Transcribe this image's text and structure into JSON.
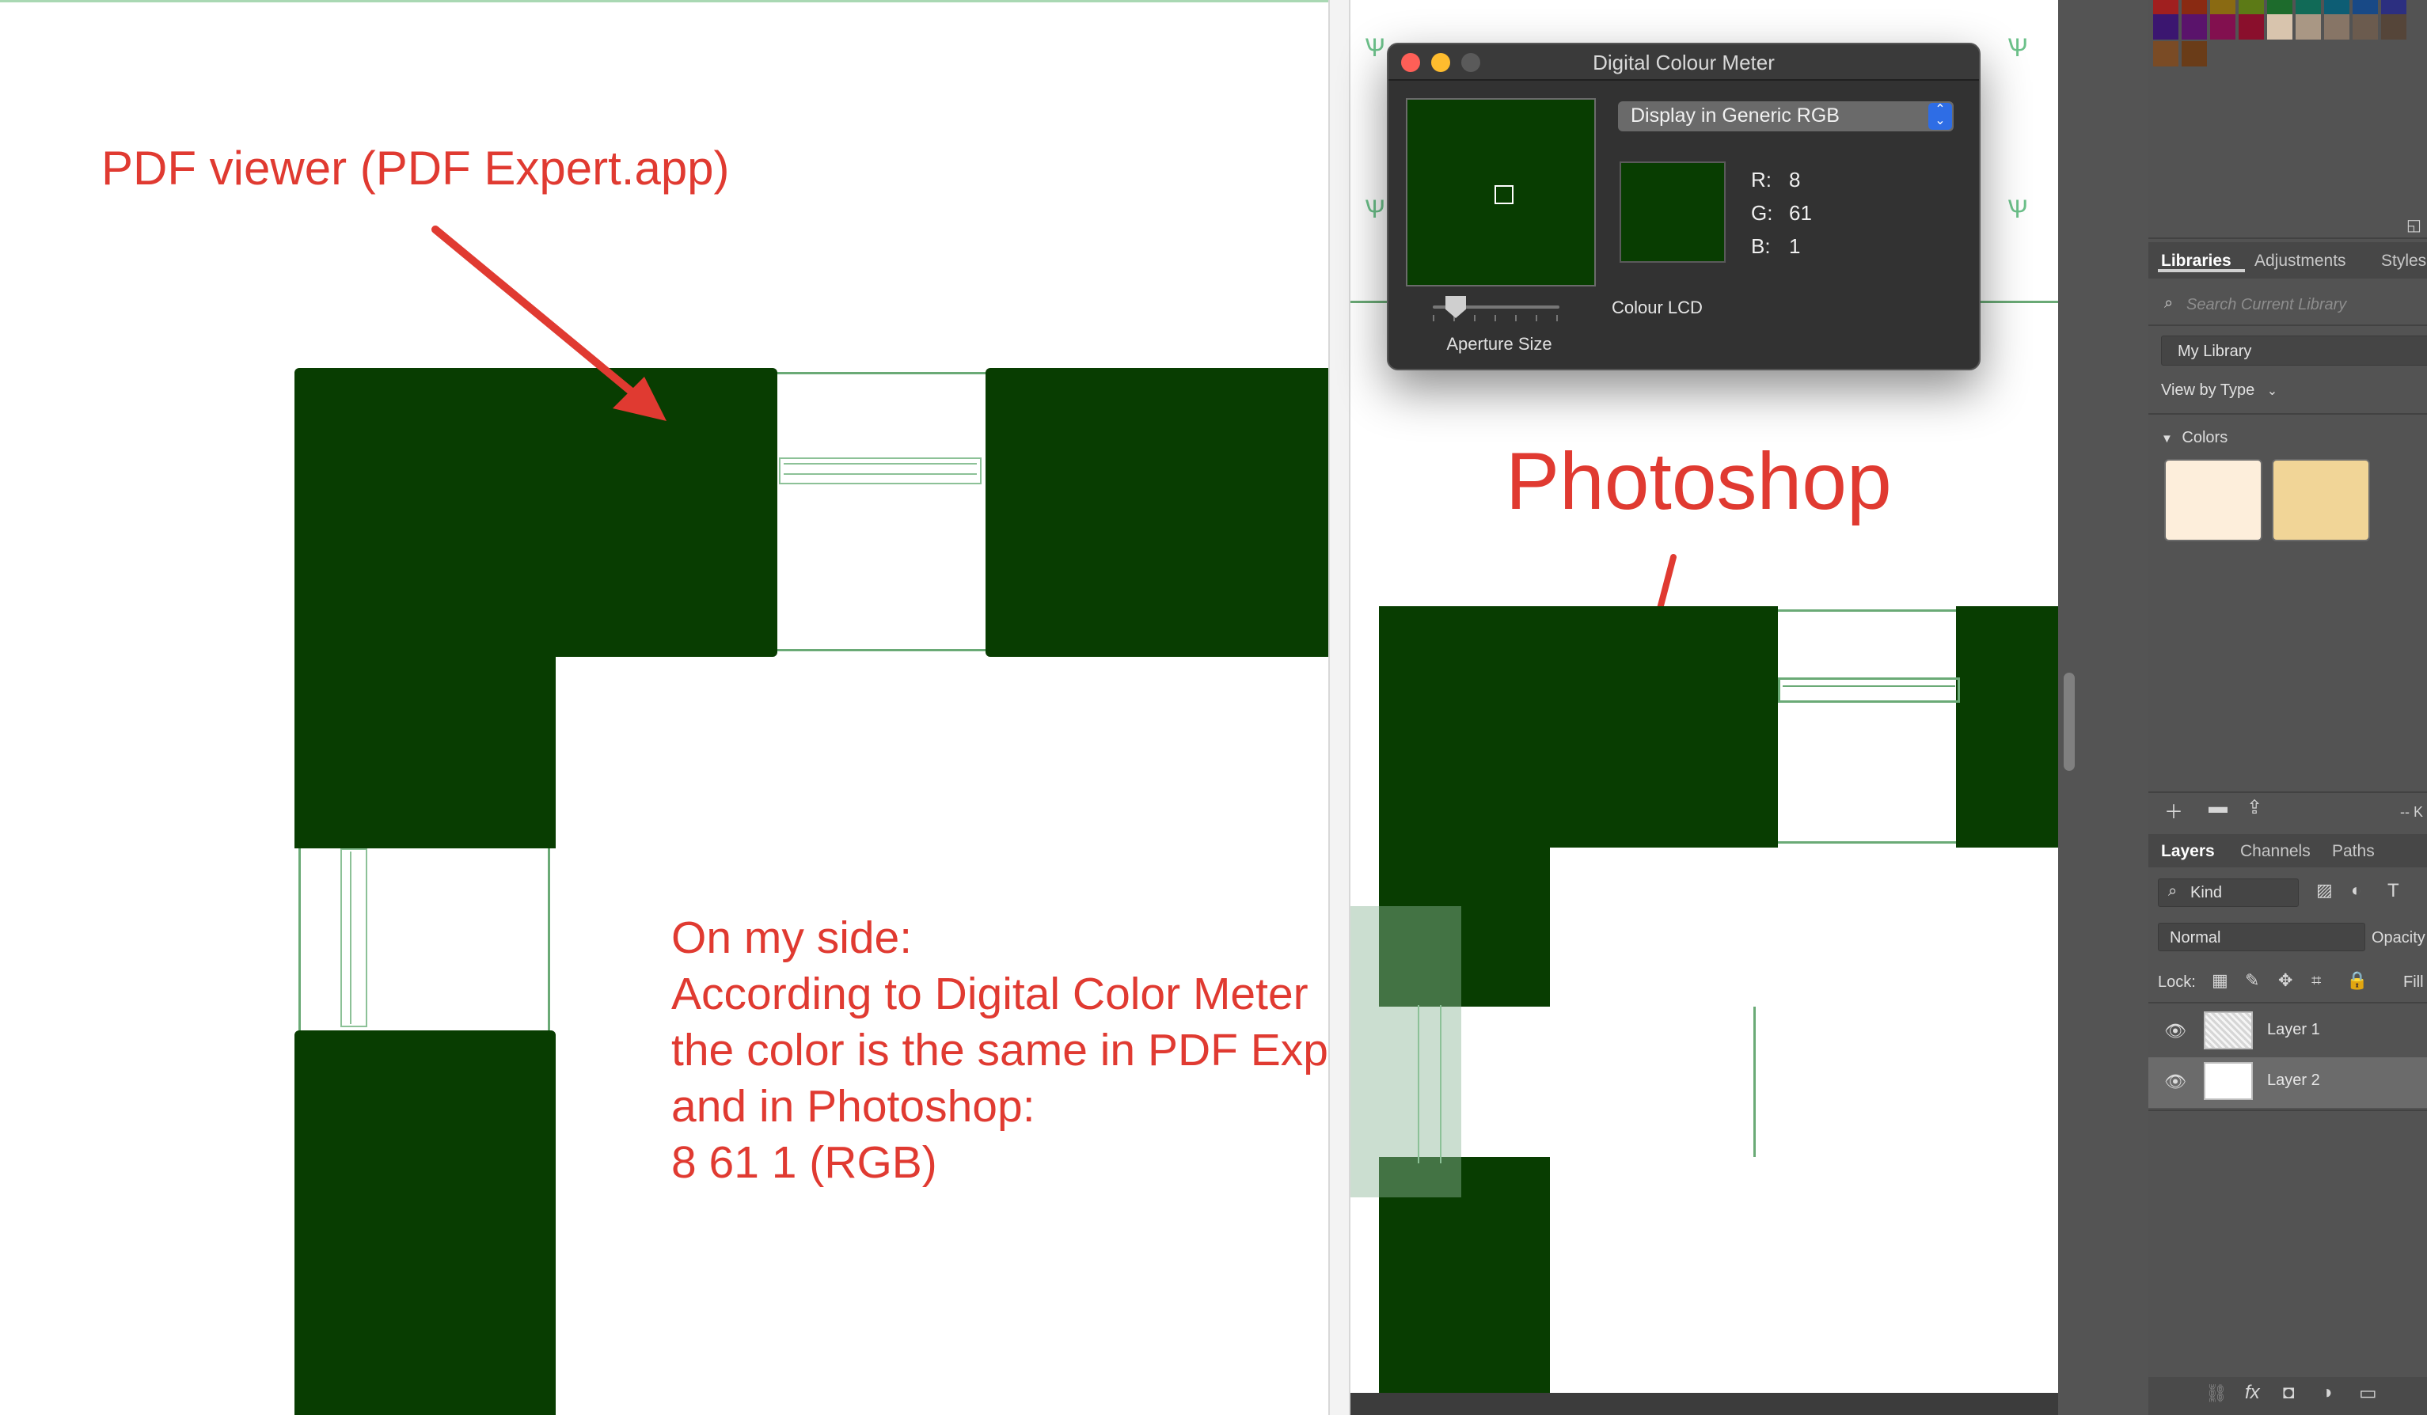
{
  "annotations": {
    "pdf_viewer_label": "PDF viewer (PDF Expert.app)",
    "photoshop_label": "Photoshop",
    "note_lines": [
      "On my side:",
      "According to Digital Color Meter",
      "the color is the same in PDF Expert",
      "and in Photoshop:",
      "8 61 1 (RGB)"
    ]
  },
  "colors": {
    "sampled_green": "#083d01",
    "annotation_red": "#e03a31",
    "outline_green": "#6aaa76"
  },
  "digital_colour_meter": {
    "title": "Digital Colour Meter",
    "display_mode": "Display in Generic RGB",
    "r_label": "R:",
    "r_value": "8",
    "g_label": "G:",
    "g_value": "61",
    "b_label": "B:",
    "b_value": "1",
    "display_name": "Colour LCD",
    "aperture_label": "Aperture Size"
  },
  "libraries_panel": {
    "tabs": [
      "Libraries",
      "Adjustments",
      "Styles"
    ],
    "search_placeholder": "Search Current Library",
    "library_name": "My Library",
    "view_by": "View by Type",
    "colors_section": "Colors",
    "library_colors": [
      "#fdeedb",
      "#f1d597"
    ],
    "status_text": "-- K"
  },
  "layers_panel": {
    "tabs": [
      "Layers",
      "Channels",
      "Paths"
    ],
    "filter_kind": "Kind",
    "blend_mode": "Normal",
    "opacity_label": "Opacity",
    "lock_label": "Lock:",
    "fill_label": "Fill",
    "layers": [
      {
        "name": "Layer 1"
      },
      {
        "name": "Layer 2"
      }
    ]
  }
}
